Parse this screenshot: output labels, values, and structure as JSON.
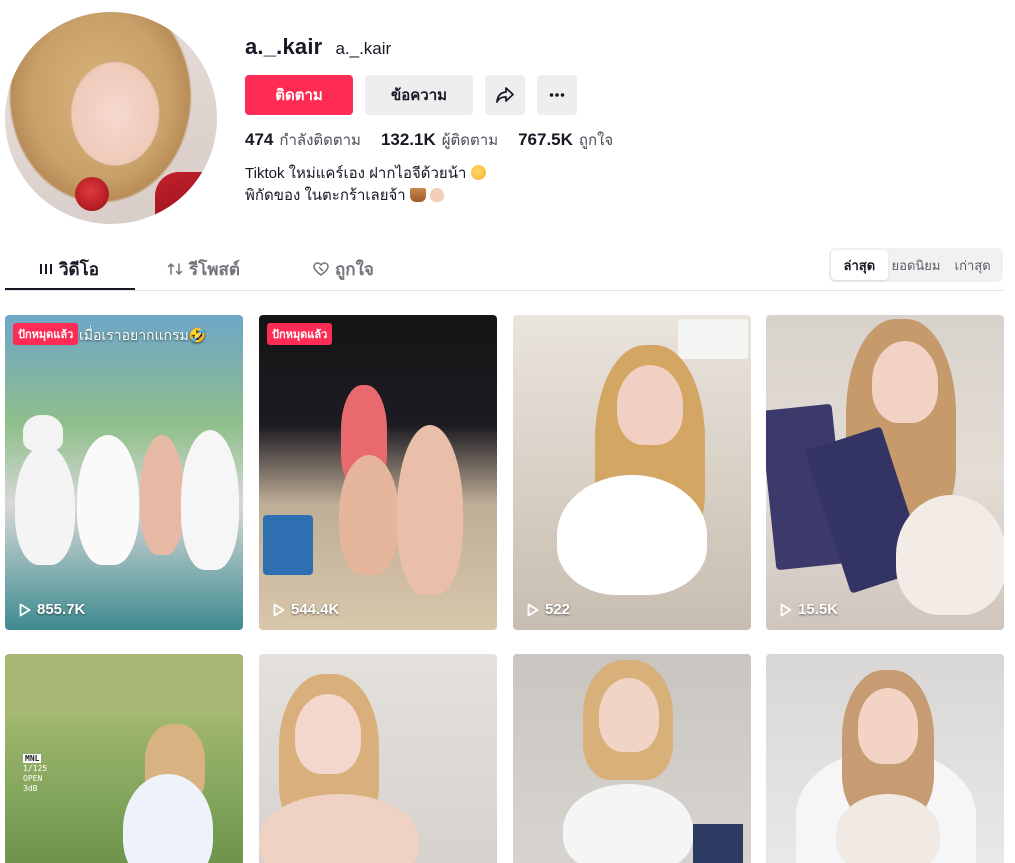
{
  "profile": {
    "title": "a._.kair",
    "subtitle": "a._.kair",
    "buttons": {
      "follow": "ติดตาม",
      "message": "ข้อความ"
    },
    "stats": [
      {
        "value": "474",
        "label": "กำลังติดตาม"
      },
      {
        "value": "132.1K",
        "label": "ผู้ติดตาม"
      },
      {
        "value": "767.5K",
        "label": "ถูกใจ"
      }
    ],
    "bio": {
      "line1": "Tiktok ใหม่แคร์เอง ฝากไอจีด้วยน้า",
      "line2": "พิกัดของ ในตะกร้าเลยจ้า"
    }
  },
  "tabs": [
    {
      "label": "วิดีโอ",
      "icon": "grid-icon"
    },
    {
      "label": "รีโพสต์",
      "icon": "repost-icon"
    },
    {
      "label": "ถูกใจ",
      "icon": "heart-icon"
    }
  ],
  "sort": [
    "ล่าสุด",
    "ยอดนิยม",
    "เก่าสุด"
  ],
  "videos": [
    {
      "pinned": "ปักหมุดแล้ว",
      "overlay": "เมื่อเราอยากแกรม🤣",
      "views": "855.7K"
    },
    {
      "pinned": "ปักหมุดแล้ว",
      "views": "544.4K"
    },
    {
      "views": "522"
    },
    {
      "views": "15.5K"
    },
    {
      "camera": [
        "MNL",
        "1/125",
        "OPEN",
        "3dB"
      ]
    },
    {},
    {},
    {}
  ],
  "colors": {
    "accent": "#fe2c55",
    "text": "#161823",
    "muted": "#73747b"
  }
}
